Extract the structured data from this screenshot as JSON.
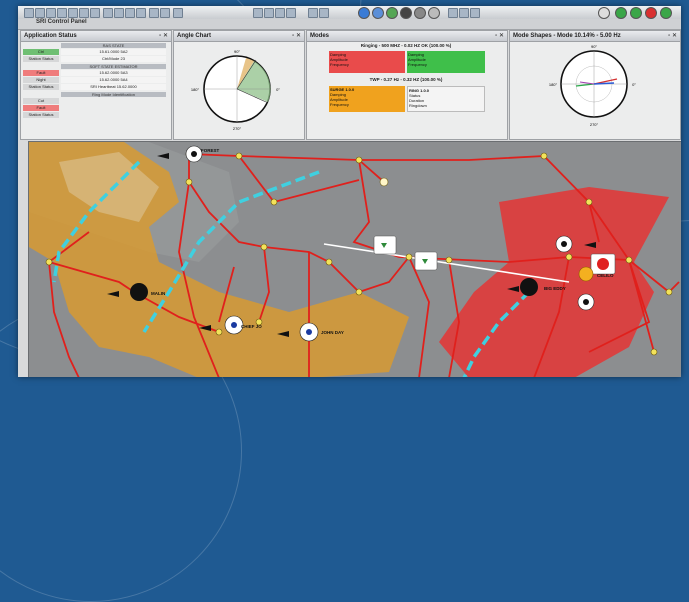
{
  "window": {
    "title": "SRI Control Panel"
  },
  "panels": {
    "app_status": {
      "title": "Application Status",
      "groups": [
        "RAS STATE",
        "SOFT STATE ESTIMATOR",
        "Ring Mode Identification"
      ],
      "rows": [
        {
          "label": "Ctrl",
          "value": "15.61.0000 5A2",
          "color": "#6fbf73"
        },
        {
          "label": "Station Status",
          "value": "Ctrl/Mode 23",
          "color": "#d6d7d8"
        },
        {
          "label": "Fault",
          "value": "15.62.0000 5A3",
          "color": "#ef7c7c"
        },
        {
          "label": "Night",
          "value": "15.62.0000 5A4",
          "color": "#d6d7d8"
        },
        {
          "label": "Station Status",
          "value": "SRI Heartbeat 15.62.0000",
          "color": "#d6d7d8"
        },
        {
          "label": "Cut",
          "value": "",
          "color": "#d6d7d8"
        },
        {
          "label": "Fault",
          "value": "",
          "color": "#ef7c7c"
        },
        {
          "label": "Station Status",
          "value": "",
          "color": "#d6d7d8"
        }
      ]
    },
    "angle_chart": {
      "title": "Angle Chart",
      "top": "90°",
      "left": "180°",
      "right": "0°",
      "bottom": "270°"
    },
    "modes": {
      "title": "Modes",
      "primary_header": "Ringing - 500 MHZ - 0.02 HZ OK (100.00 %)",
      "secondary_header": "TWP - 0.27 Hz - 0.32 HZ (100.00 %)",
      "cells": [
        {
          "lines": [
            "Damping",
            "Amplitude",
            "Frequency"
          ],
          "values": [
            "1.23",
            "0.54",
            "0.021"
          ],
          "color": "#e94b4b"
        },
        {
          "lines": [
            "Damping",
            "Amplitude",
            "Frequency"
          ],
          "values": [
            "12.35",
            "1.00",
            "0.020"
          ],
          "color": "#3fbf4a"
        },
        {
          "lines": [
            "Damping",
            "Amplitude",
            "Frequency"
          ],
          "values": [
            "4.21",
            "0.33",
            "0.270"
          ],
          "color": "#f0a21e"
        },
        {
          "lines": [
            "Status",
            "Duration",
            "Ringdown"
          ],
          "values": [
            "OK",
            "12",
            "3"
          ],
          "color": "#f4f4f4"
        }
      ],
      "sub_labels": [
        "SURGE 1.0.0",
        "RING 1.0.0"
      ]
    },
    "mode_shapes": {
      "title": "Mode Shapes - Mode 10.14% - 5.00 Hz",
      "left": "180°",
      "right": "0°",
      "top": "90°",
      "bottom": "270°"
    }
  },
  "map": {
    "labels": [
      "FOREST",
      "MALIN",
      "CHIEF JO",
      "JOHN DAY",
      "BIG EDDY",
      "CELILO"
    ],
    "flag_icons": [
      "alarm-flag",
      "info-flag",
      "info-flag",
      "warning-flag"
    ],
    "colors": {
      "region_orange": "#d79a32",
      "region_red": "#e03a3a",
      "lines": "#e0201c",
      "dc_line": "#3fd0e0"
    }
  }
}
